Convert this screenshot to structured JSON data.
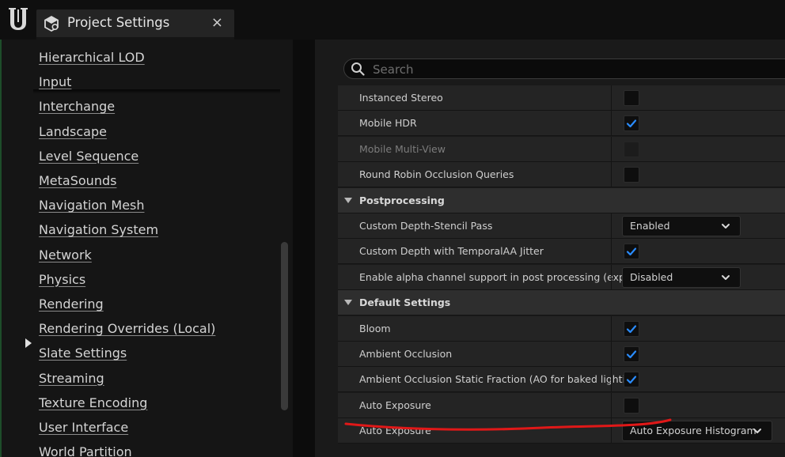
{
  "window": {
    "tab_title": "Project Settings",
    "close_glyph": "×"
  },
  "icons": {
    "app_logo": "unreal-engine-logo",
    "tab_icon": "settings-cube-icon",
    "search": "search-icon",
    "checkmark": "checkmark-icon",
    "chevron": "chevron-down-icon",
    "expanded_marker": "triangle-right-icon"
  },
  "sidebar": {
    "items": [
      {
        "label": "Hierarchical LOD"
      },
      {
        "label": "Input"
      },
      {
        "label": "Interchange"
      },
      {
        "label": "Landscape"
      },
      {
        "label": "Level Sequence"
      },
      {
        "label": "MetaSounds"
      },
      {
        "label": "Navigation Mesh"
      },
      {
        "label": "Navigation System"
      },
      {
        "label": "Network"
      },
      {
        "label": "Physics"
      },
      {
        "label": "Rendering",
        "active": true
      },
      {
        "label": "Rendering Overrides (Local)"
      },
      {
        "label": "Slate Settings"
      },
      {
        "label": "Streaming"
      },
      {
        "label": "Texture Encoding"
      },
      {
        "label": "User Interface"
      },
      {
        "label": "World Partition"
      }
    ]
  },
  "search": {
    "placeholder": "Search",
    "value": ""
  },
  "rows": [
    {
      "kind": "property",
      "label": "Instanced Stereo",
      "control": "checkbox",
      "checked": false
    },
    {
      "kind": "property",
      "label": "Mobile HDR",
      "control": "checkbox",
      "checked": true
    },
    {
      "kind": "property",
      "label": "Mobile Multi-View",
      "control": "checkbox",
      "checked": false,
      "disabled": true
    },
    {
      "kind": "property",
      "label": "Round Robin Occlusion Queries",
      "control": "checkbox",
      "checked": false
    },
    {
      "kind": "section",
      "label": "Postprocessing"
    },
    {
      "kind": "property",
      "label": "Custom Depth-Stencil Pass",
      "control": "dropdown",
      "value": "Enabled"
    },
    {
      "kind": "property",
      "label": "Custom Depth with TemporalAA Jitter",
      "control": "checkbox",
      "checked": true
    },
    {
      "kind": "property",
      "label": "Enable alpha channel support in post processing (exp...",
      "control": "dropdown",
      "value": "Disabled"
    },
    {
      "kind": "section",
      "label": "Default Settings"
    },
    {
      "kind": "property",
      "label": "Bloom",
      "control": "checkbox",
      "checked": true
    },
    {
      "kind": "property",
      "label": "Ambient Occlusion",
      "control": "checkbox",
      "checked": true
    },
    {
      "kind": "property",
      "label": "Ambient Occlusion Static Fraction (AO for baked lighti...",
      "control": "checkbox",
      "checked": true
    },
    {
      "kind": "property",
      "label": "Auto Exposure",
      "control": "checkbox",
      "checked": false
    },
    {
      "kind": "property",
      "label": "Auto Exposure",
      "control": "dropdown",
      "value": "Auto Exposure Histogram",
      "wide": true
    }
  ],
  "colors": {
    "accent_check": "#2a8cff",
    "annotation": "#e01818"
  }
}
